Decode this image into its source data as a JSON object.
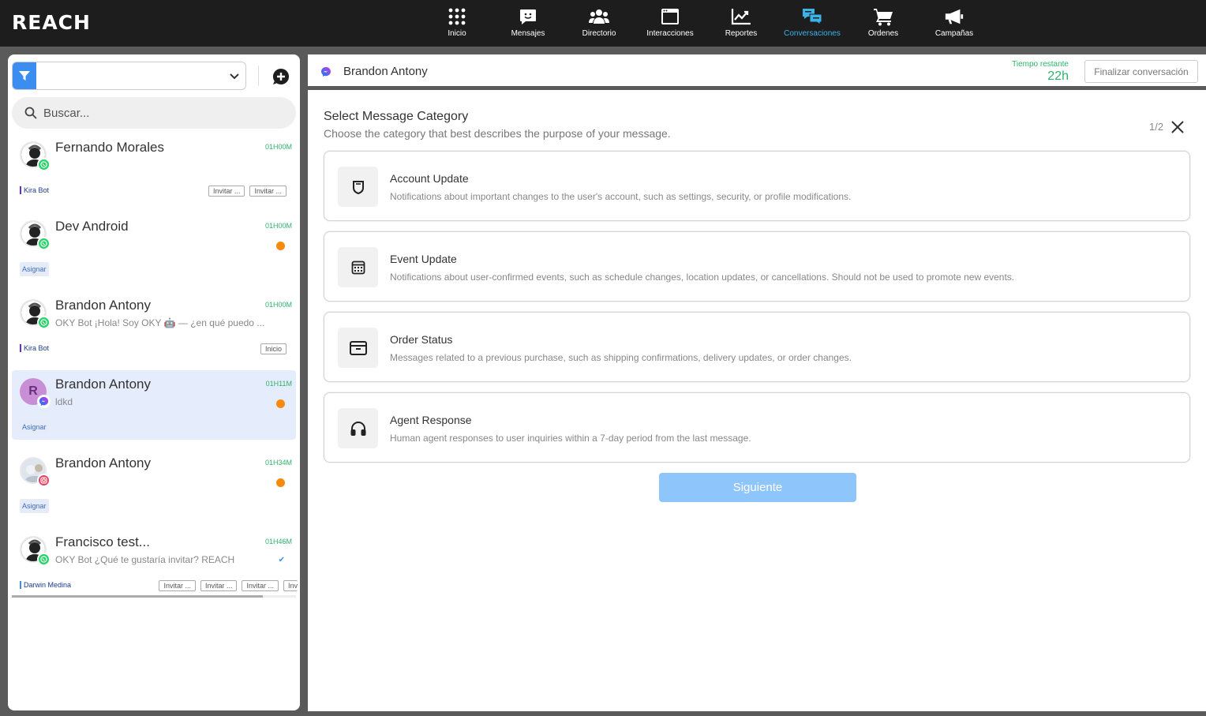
{
  "app": {
    "logo": "REACH"
  },
  "nav": [
    {
      "label": "Inicio",
      "icon": "grid-icon",
      "active": false
    },
    {
      "label": "Mensajes",
      "icon": "message-smile-icon",
      "active": false
    },
    {
      "label": "Directorio",
      "icon": "users-icon",
      "active": false
    },
    {
      "label": "Interacciones",
      "icon": "window-icon",
      "active": false
    },
    {
      "label": "Reportes",
      "icon": "chart-line-icon",
      "active": false
    },
    {
      "label": "Conversaciones",
      "icon": "chat-bubbles-icon",
      "active": true
    },
    {
      "label": "Ordenes",
      "icon": "cart-icon",
      "active": false
    },
    {
      "label": "Campañas",
      "icon": "megaphone-icon",
      "active": false
    }
  ],
  "sidebar": {
    "search_placeholder": "Buscar...",
    "conversations": [
      {
        "name": "Fernando Morales",
        "time": "01H00M",
        "preview": "",
        "channel": "whatsapp",
        "agent": "Kira Bot",
        "tags": [
          "Invitar ...",
          "Invitar ..."
        ],
        "unread": false
      },
      {
        "name": "Dev Android",
        "time": "01H00M",
        "preview": "",
        "channel": "whatsapp",
        "assign": "Asignar",
        "unread": true
      },
      {
        "name": "Brandon Antony",
        "time": "01H00M",
        "preview": "OKY Bot ¡Hola! Soy OKY 🤖 — ¿en qué puedo ...",
        "channel": "whatsapp",
        "agent": "Kira Bot",
        "tags": [
          "Inicio"
        ],
        "unread": false
      },
      {
        "name": "Brandon Antony",
        "time": "01H11M",
        "preview": "ldkd",
        "channel": "messenger",
        "avatar_letter": "R",
        "assign": "Asignar",
        "unread": true,
        "selected": true
      },
      {
        "name": "Brandon Antony",
        "time": "01H34M",
        "preview": "",
        "channel": "instagram",
        "assign": "Asignar",
        "unread": true
      },
      {
        "name": "Francisco test...",
        "time": "01H46M",
        "preview": "OKY Bot ¿Qué te gustaría invitar? REACH",
        "channel": "whatsapp",
        "agent": "Darwin Medina",
        "tags": [
          "Invitar ...",
          "Invitar ...",
          "Invitar ...",
          "Inv"
        ],
        "unread": false
      }
    ]
  },
  "chat": {
    "contact_name": "Brandon Antony",
    "time_label": "Tiempo restante",
    "time_value": "22h",
    "end_button": "Finalizar conversación"
  },
  "category": {
    "title": "Select Message Category",
    "subtitle": "Choose the category that best describes the purpose of your message.",
    "step": "1/2",
    "options": [
      {
        "title": "Account Update",
        "desc": "Notifications about important changes to the user's account, such as settings, security, or profile modifications.",
        "icon": "shield-icon"
      },
      {
        "title": "Event Update",
        "desc": "Notifications about user-confirmed events, such as schedule changes, location updates, or cancellations. Should not be used to promote new events.",
        "icon": "calendar-icon"
      },
      {
        "title": "Order Status",
        "desc": "Messages related to a previous purchase, such as shipping confirmations, delivery updates, or order changes.",
        "icon": "archive-box-icon"
      },
      {
        "title": "Agent Response",
        "desc": "Human agent responses to user inquiries within a 7-day period from the last message.",
        "icon": "headphones-icon"
      }
    ],
    "next_button": "Siguiente"
  },
  "colors": {
    "topbar": "#1d1d1d",
    "accent": "#3ab4e8",
    "primary_button": "#8ec5fa",
    "time_green": "#2db36b",
    "unread_dot": "#f7890e"
  }
}
